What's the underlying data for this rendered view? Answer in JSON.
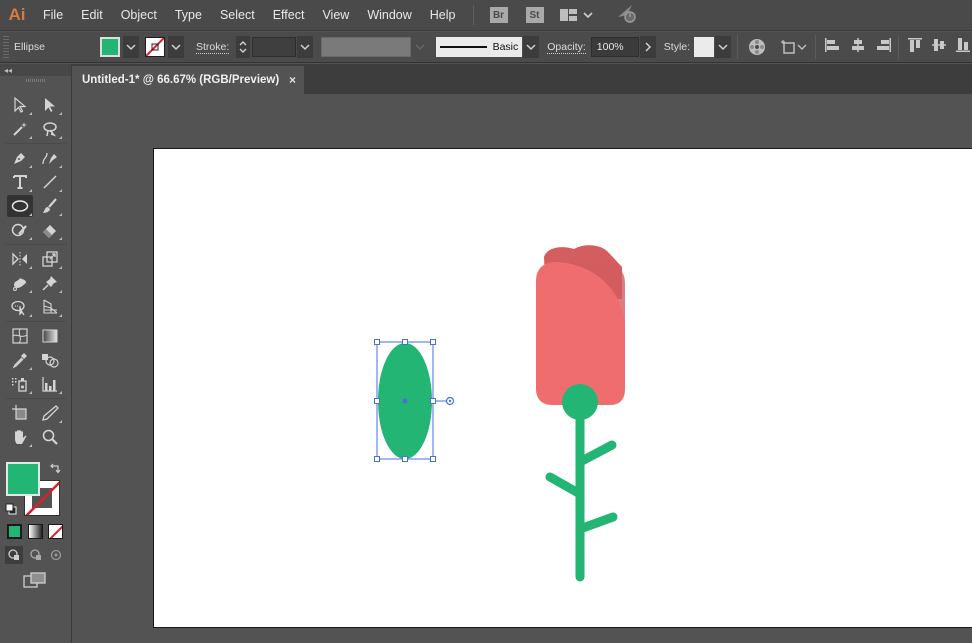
{
  "app": {
    "logo": "Ai"
  },
  "menu": {
    "items": [
      "File",
      "Edit",
      "Object",
      "Type",
      "Select",
      "Effect",
      "View",
      "Window",
      "Help"
    ],
    "bridge_label": "Br",
    "stock_label": "St"
  },
  "control_bar": {
    "selection_type": "Ellipse",
    "fill_color": "#22b573",
    "stroke_label": "Stroke:",
    "stroke_weight": "",
    "brush_profile": "Basic",
    "opacity_label": "Opacity:",
    "opacity_value": "100%",
    "style_label": "Style:"
  },
  "document_tab": {
    "title": "Untitled-1* @ 66.67% (RGB/Preview)",
    "close_glyph": "×"
  },
  "toolbox": {
    "collapse_glyph": "◂◂",
    "fill_color": "#22b573",
    "stroke_color": "none",
    "tools": [
      "selection-tool",
      "direct-selection-tool",
      "magic-wand-tool",
      "lasso-tool",
      "pen-tool",
      "curvature-tool",
      "type-tool",
      "line-segment-tool",
      "ellipse-tool",
      "paintbrush-tool",
      "shaper-tool",
      "eraser-tool",
      "reflect-tool",
      "scale-tool",
      "puppet-warp-tool",
      "pin-tool",
      "shape-builder-tool",
      "perspective-grid-tool",
      "mesh-tool",
      "gradient-tool",
      "eyedropper-tool",
      "blend-tool",
      "symbol-sprayer-tool",
      "column-graph-tool",
      "artboard-tool",
      "slice-tool",
      "hand-tool",
      "zoom-tool"
    ],
    "active_tool": "ellipse-tool"
  },
  "artwork": {
    "leaf_color": "#22b573",
    "petal_color": "#f06d6f",
    "petal_shadow_color": "#d35d5f",
    "stem_color": "#22b573",
    "selection_color": "#4a6fd8"
  }
}
